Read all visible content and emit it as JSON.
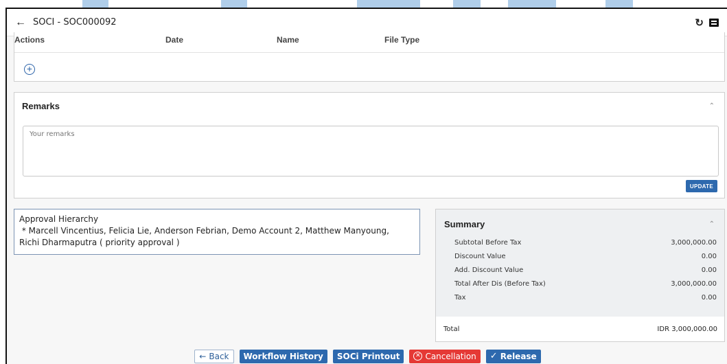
{
  "header": {
    "title": "SOCI - SOC000092"
  },
  "attachments": {
    "columns": [
      "Actions",
      "Date",
      "Name",
      "File Type"
    ]
  },
  "remarks": {
    "title": "Remarks",
    "placeholder": "Your remarks",
    "update_label": "UPDATE"
  },
  "approval": {
    "title": "Approval Hierarchy",
    "line1": " * Marcell Vincentius, Felicia Lie, Anderson Febrian, Demo Account 2, Matthew Manyoung,",
    "line2": "Richi Dharmaputra ( priority approval )"
  },
  "summary": {
    "title": "Summary",
    "rows": [
      {
        "label": "Subtotal Before Tax",
        "value": "3,000,000.00"
      },
      {
        "label": "Discount Value",
        "value": "0.00"
      },
      {
        "label": "Add. Discount Value",
        "value": "0.00"
      },
      {
        "label": "Total After Dis (Before Tax)",
        "value": "3,000,000.00"
      },
      {
        "label": "Tax",
        "value": "0.00"
      }
    ],
    "total_label": "Total",
    "total_value": "IDR 3,000,000.00"
  },
  "footer": {
    "back_label": "Back",
    "workflow_label": "Workflow History",
    "printout_label": "SOCi Printout",
    "cancel_label": "Cancellation",
    "release_label": "Release"
  },
  "colors": {
    "primary": "#2d69ae",
    "danger": "#e53935"
  }
}
